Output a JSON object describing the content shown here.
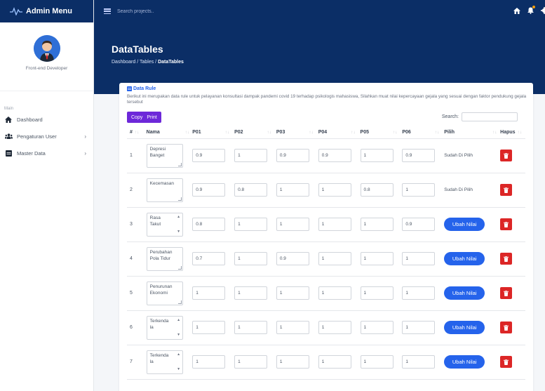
{
  "app": {
    "brand_title": "Admin Menu",
    "colors": {
      "topbar": "#0b2e66",
      "primary": "#2563eb",
      "accent_purple": "#6d28d9",
      "danger": "#dc2626"
    }
  },
  "sidebar": {
    "profile_role": "Front-end Developer",
    "section_label": "Main",
    "items": [
      {
        "label": "Dashboard",
        "icon": "home-icon",
        "has_children": false
      },
      {
        "label": "Pengaturan User",
        "icon": "users-icon",
        "has_children": true
      },
      {
        "label": "Master Data",
        "icon": "database-icon",
        "has_children": true
      }
    ]
  },
  "topbar": {
    "search_placeholder": "Search projects..",
    "icons": [
      "home-icon",
      "bell-icon",
      "gear-icon"
    ]
  },
  "header": {
    "title": "DataTables",
    "breadcrumb": [
      "Dashboard",
      "Tables",
      "DataTables"
    ],
    "breadcrumb_sep": "/"
  },
  "card": {
    "title": "Data Rule",
    "description": "Berikut ini merupakan data rule untuk pelayanan konsultasi dampak pandemi covid 19 terhadap psikologis mahasiswa, Silahkan muat nilai kepercayaan gejala yang sesuai dengan faktor pendukung gejala tersebut",
    "buttons": {
      "copy": "Copy",
      "print": "Print"
    },
    "search_label": "Search:",
    "columns": [
      "#",
      "Nama",
      "P01",
      "P02",
      "P03",
      "P04",
      "P05",
      "P06",
      "Pilih",
      "Hapus"
    ],
    "rows": [
      {
        "no": "1",
        "nama": [
          "Depresi",
          "Banget"
        ],
        "spin": false,
        "vals": [
          "0.9",
          "1",
          "0.9",
          "0.9",
          "1",
          "0.9"
        ],
        "pilih_type": "text",
        "pilih": "Sudah Di Pilih"
      },
      {
        "no": "2",
        "nama": [
          "Kecemasan",
          ""
        ],
        "spin": false,
        "vals": [
          "0.9",
          "0.8",
          "1",
          "1",
          "0.8",
          "1"
        ],
        "pilih_type": "text",
        "pilih": "Sudah Di Pilih"
      },
      {
        "no": "3",
        "nama": [
          "Rasa",
          "Takut"
        ],
        "spin": true,
        "vals": [
          "0.8",
          "1",
          "1",
          "1",
          "1",
          "0.9"
        ],
        "pilih_type": "button",
        "pilih": "Ubah Nilai"
      },
      {
        "no": "4",
        "nama": [
          "Perubahan",
          "Pola Tidur"
        ],
        "spin": false,
        "vals": [
          "0.7",
          "1",
          "0.9",
          "1",
          "1",
          "1"
        ],
        "pilih_type": "button",
        "pilih": "Ubah Nilai"
      },
      {
        "no": "5",
        "nama": [
          "Penurunan",
          "Ekonomi"
        ],
        "spin": false,
        "vals": [
          "1",
          "1",
          "1",
          "1",
          "1",
          "1"
        ],
        "pilih_type": "button",
        "pilih": "Ubah Nilai"
      },
      {
        "no": "6",
        "nama": [
          "Terkenda",
          "la"
        ],
        "spin": true,
        "vals": [
          "1",
          "1",
          "1",
          "1",
          "1",
          "1"
        ],
        "pilih_type": "button",
        "pilih": "Ubah Nilai"
      },
      {
        "no": "7",
        "nama": [
          "Terkenda",
          "la"
        ],
        "spin": true,
        "vals": [
          "1",
          "1",
          "1",
          "1",
          "1",
          "1"
        ],
        "pilih_type": "button",
        "pilih": "Ubah Nilai"
      }
    ]
  }
}
